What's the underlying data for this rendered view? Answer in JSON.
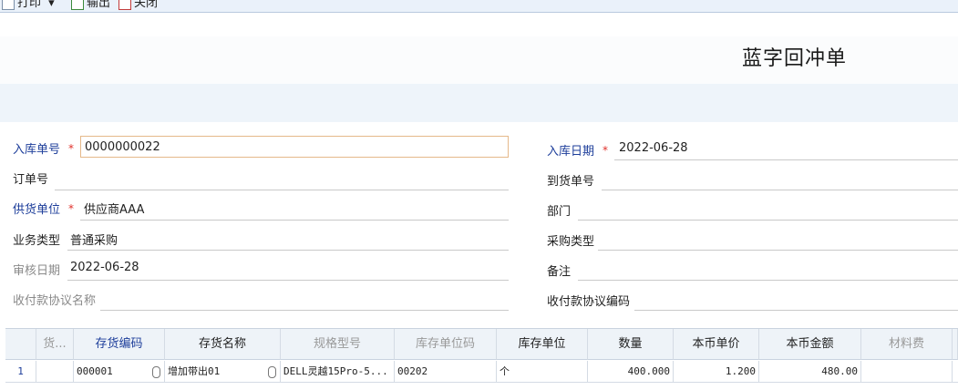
{
  "toolbar": {
    "print_label": "打印",
    "print_dropdown": "▾",
    "export_label": "输出",
    "close_label": "关闭"
  },
  "title": "蓝字回冲单",
  "form": {
    "warehouse_no": {
      "label": "入库单号",
      "value": "0000000022",
      "required": true
    },
    "order_no": {
      "label": "订单号",
      "value": ""
    },
    "supplier": {
      "label": "供货单位",
      "value": "供应商AAA",
      "required": true
    },
    "business_type": {
      "label": "业务类型",
      "value": "普通采购"
    },
    "audit_date": {
      "label": "审核日期",
      "value": "2022-06-28"
    },
    "payment_agreement_name": {
      "label": "收付款协议名称",
      "value": ""
    },
    "warehouse_date": {
      "label": "入库日期",
      "value": "2022-06-28",
      "required": true
    },
    "arrival_no": {
      "label": "到货单号",
      "value": ""
    },
    "department": {
      "label": "部门",
      "value": ""
    },
    "purchase_type": {
      "label": "采购类型",
      "value": ""
    },
    "remark": {
      "label": "备注",
      "value": ""
    },
    "payment_agreement_code": {
      "label": "收付款协议编码",
      "value": ""
    },
    "required_mark": "*"
  },
  "grid": {
    "headers": [
      "货...",
      "存货编码",
      "存货名称",
      "规格型号",
      "库存单位码",
      "库存单位",
      "数量",
      "本币单价",
      "本币金额",
      "材料费"
    ],
    "rows": [
      {
        "row_no": "1",
        "goods": "",
        "code": "000001",
        "name": "增加带出01",
        "spec": "DELL灵越15Pro-5...",
        "unit_code": "00202",
        "unit": "个",
        "qty": "400.000",
        "price": "1.200",
        "amount": "480.00",
        "material": ""
      }
    ]
  },
  "colors": {
    "required_label": "#1c3d9a",
    "required_star": "#e0312b",
    "toolbar_bg": "#eaf1fa",
    "band_bg": "#eef4fa",
    "input_border": "#e5b98a"
  }
}
